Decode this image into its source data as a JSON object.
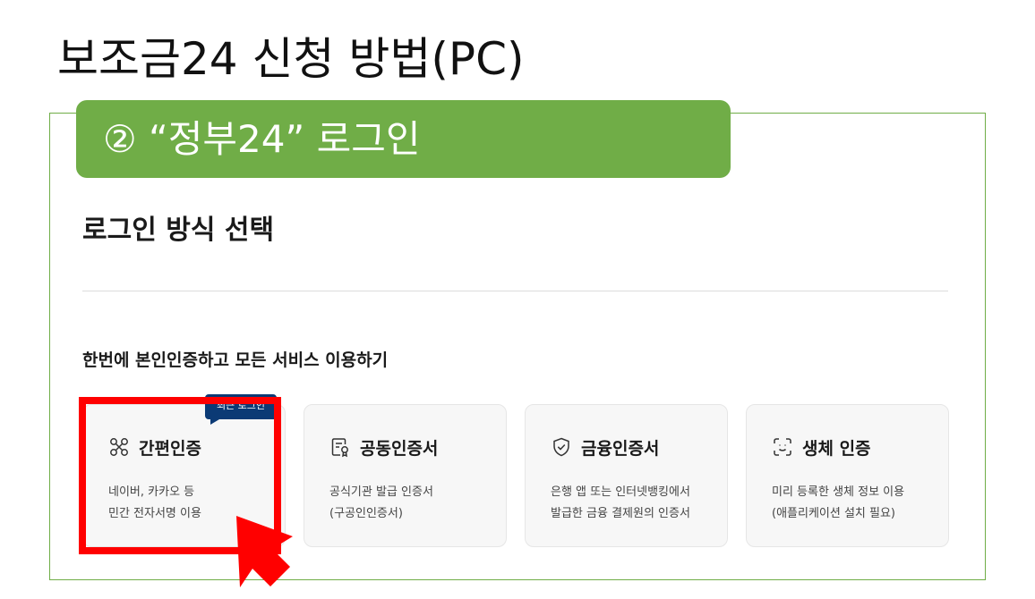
{
  "slide": {
    "title": "보조금24 신청 방법(PC)",
    "step_label": "② “정부24” 로그인"
  },
  "page": {
    "heading": "로그인 방식 선택",
    "section_heading": "한번에 본인인증하고 모든 서비스 이용하기"
  },
  "login_methods": [
    {
      "title": "간편인증",
      "icon": "link-nodes-icon",
      "desc_line1": "네이버, 카카오 등",
      "desc_line2": "민간 전자서명 이용",
      "badge": "최근 로그인",
      "highlighted": true
    },
    {
      "title": "공동인증서",
      "icon": "certificate-icon",
      "desc_line1": "공식기관 발급 인증서",
      "desc_line2": "(구공인인증서)"
    },
    {
      "title": "금융인증서",
      "icon": "shield-check-icon",
      "desc_line1": "은행 앱 또는 인터넷뱅킹에서",
      "desc_line2": "발급한 금융 결제원의 인증서"
    },
    {
      "title": "생체 인증",
      "icon": "face-scan-icon",
      "desc_line1": "미리 등록한 생체 정보 이용",
      "desc_line2": "(애플리케이션 설치 필요)"
    }
  ],
  "colors": {
    "accent_green": "#70ad47",
    "badge_navy": "#0b3a75",
    "highlight_red": "#ff0000"
  }
}
